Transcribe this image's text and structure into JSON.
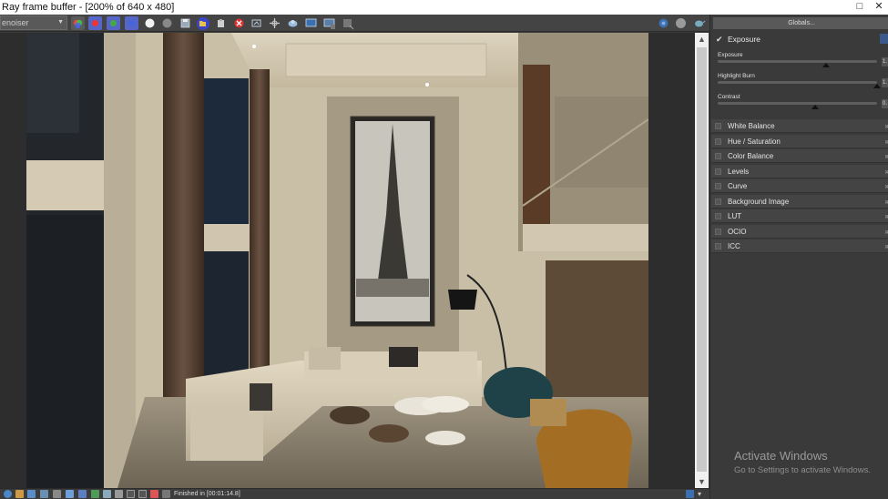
{
  "window": {
    "title": "Ray frame buffer - [200% of 640 x 480]",
    "controls": [
      "□",
      "✕"
    ]
  },
  "toolbar": {
    "denoiser_value": "enoiser",
    "buttons": [
      "channel-color-icon",
      "red-channel-icon",
      "green-channel-icon",
      "blue-channel-icon",
      "white-circle-icon",
      "gray-circle-icon",
      "save-image-icon",
      "open-folder-icon",
      "clear-icon",
      "stop-render-icon",
      "region-render-icon",
      "track-mouse-icon",
      "render-effect-icon",
      "display-icon",
      "frame-icon",
      "lens-fx-icon"
    ],
    "right_buttons": [
      "settings-icon",
      "circle-icon",
      "teapot-icon"
    ]
  },
  "status": {
    "text": "Finished in [00:01:14.8]"
  },
  "panel": {
    "globals_label": "Globals...",
    "exposure": {
      "header": "Exposure",
      "enabled": true,
      "rows": [
        {
          "label": "Exposure",
          "value": "1.",
          "level": 0.68
        },
        {
          "label": "Highlight Burn",
          "value": "1.",
          "level": 1.0
        },
        {
          "label": "Contrast",
          "value": "0.",
          "level": 0.61
        }
      ]
    },
    "sections": [
      "White Balance",
      "Hue / Saturation",
      "Color Balance",
      "Levels",
      "Curve",
      "Background Image",
      "LUT",
      "OCIO",
      "ICC"
    ]
  },
  "watermark": {
    "title": "Activate Windows",
    "subtitle": "Go to Settings to activate Windows."
  },
  "colors": {
    "accent": "#5566c8",
    "panel_bg": "#3a3a3a",
    "toolbar_bg": "#444444"
  }
}
